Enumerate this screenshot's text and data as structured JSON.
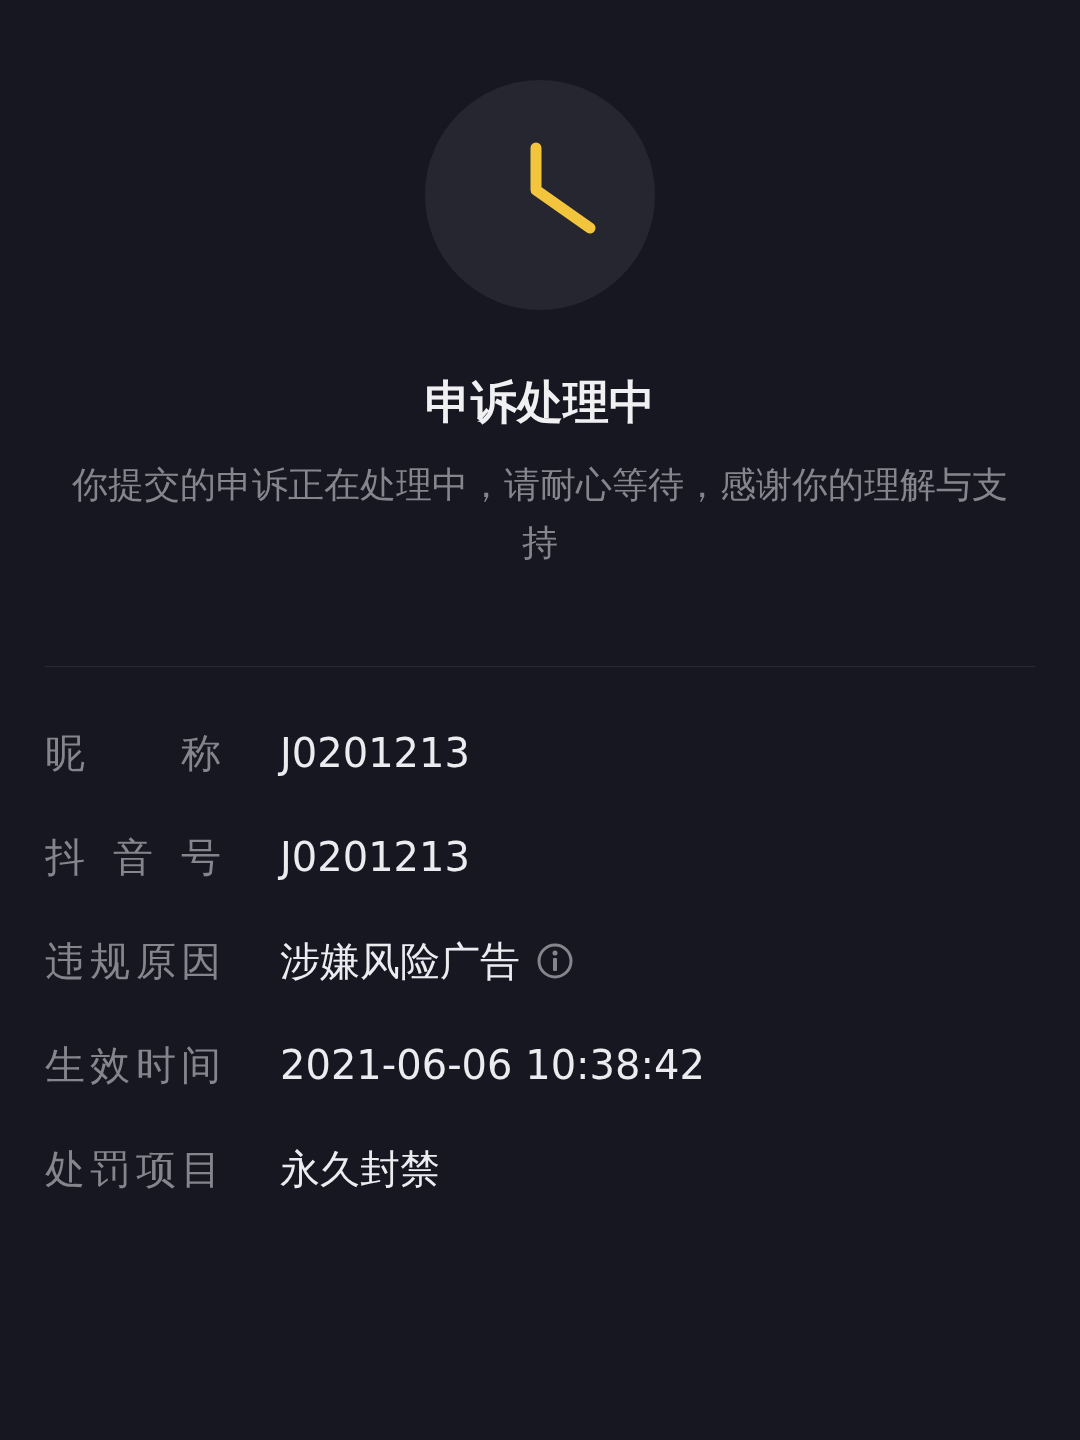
{
  "status": {
    "title": "申诉处理中",
    "message": "你提交的申诉正在处理中，请耐心等待，感谢你的理解与支持"
  },
  "details": [
    {
      "label": "昵称",
      "value": "J0201213",
      "info": false
    },
    {
      "label": "抖音号",
      "value": "J0201213",
      "info": false
    },
    {
      "label": "违规原因",
      "value": "涉嫌风险广告",
      "info": true
    },
    {
      "label": "生效时间",
      "value": "2021-06-06 10:38:42",
      "info": false
    },
    {
      "label": "处罚项目",
      "value": "永久封禁",
      "info": false
    }
  ]
}
